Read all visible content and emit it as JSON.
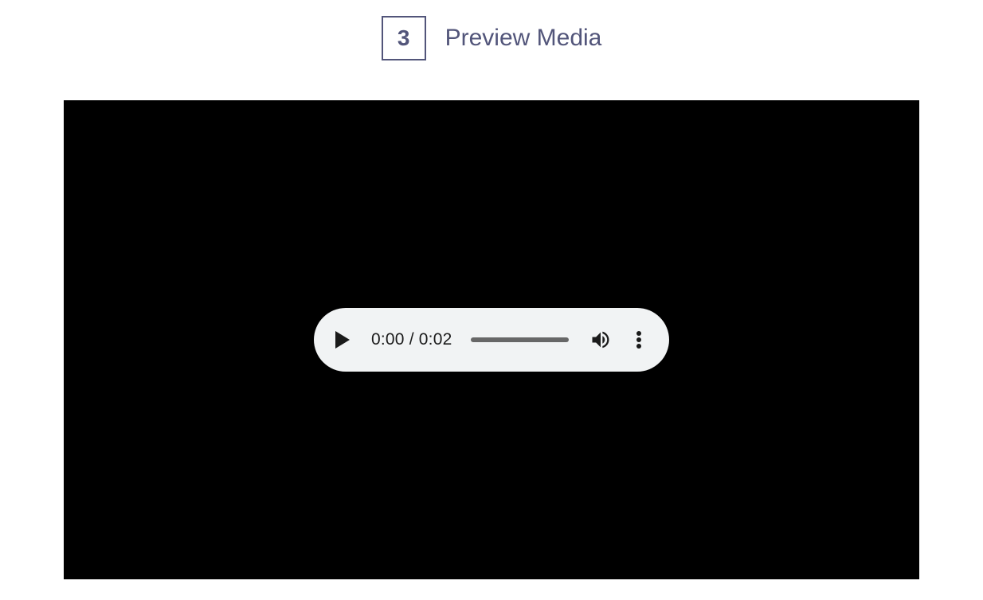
{
  "header": {
    "step_number": "3",
    "step_title": "Preview Media"
  },
  "player": {
    "current_time": "0:00",
    "separator": " / ",
    "total_time": "0:02"
  }
}
